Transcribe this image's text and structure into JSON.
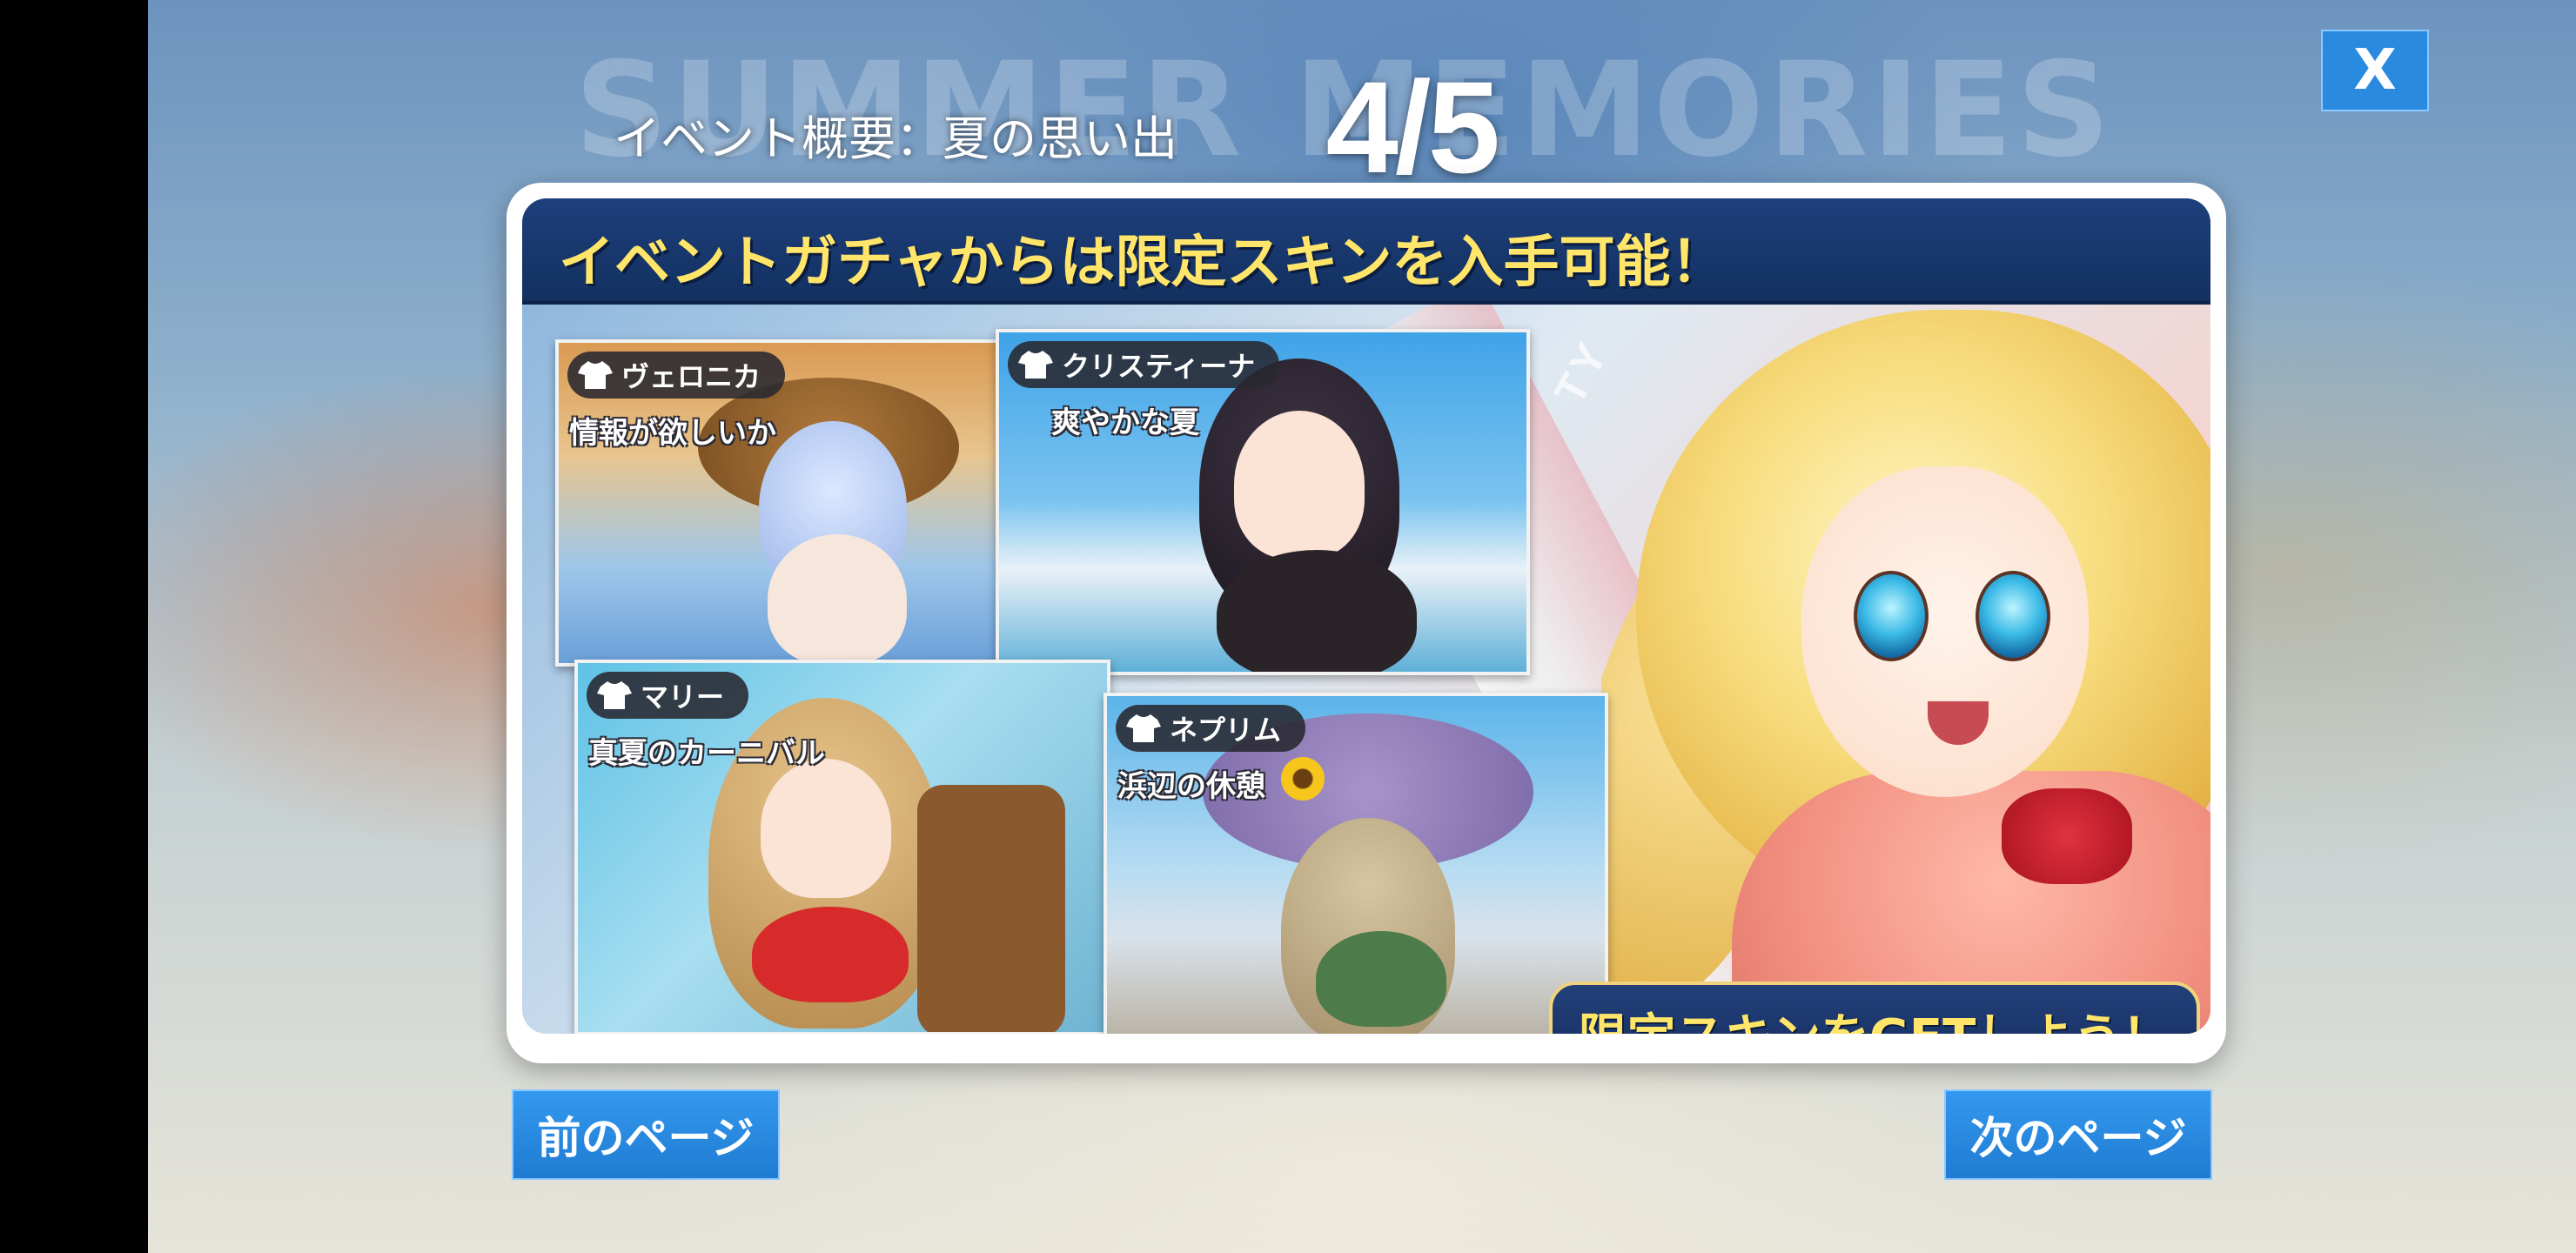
{
  "header": {
    "bg_title": "SUMMER MEMORIES",
    "event_title": "イベント概要：夏の思い出",
    "page_counter": "4/5",
    "close_label": "X"
  },
  "banner": {
    "headline": "イベントガチャからは限定スキンを入手可能！",
    "decor_text": "TY",
    "cta": "限定スキンをGETしよう！",
    "skins": [
      {
        "character": "ヴェロニカ",
        "skin_name": "情報が欲しいか",
        "icon": "shirt-icon"
      },
      {
        "character": "クリスティーナ",
        "skin_name": "爽やかな夏",
        "icon": "shirt-icon"
      },
      {
        "character": "マリー",
        "skin_name": "真夏のカーニバル",
        "icon": "shirt-icon"
      },
      {
        "character": "ネプリム",
        "skin_name": "浜辺の休憩",
        "icon": "shirt-icon"
      }
    ]
  },
  "nav": {
    "prev": "前のページ",
    "next": "次のページ"
  },
  "colors": {
    "button_blue": "#2a8ae0",
    "banner_navy": "#1e3f7c",
    "headline_yellow": "#ffe56a"
  }
}
